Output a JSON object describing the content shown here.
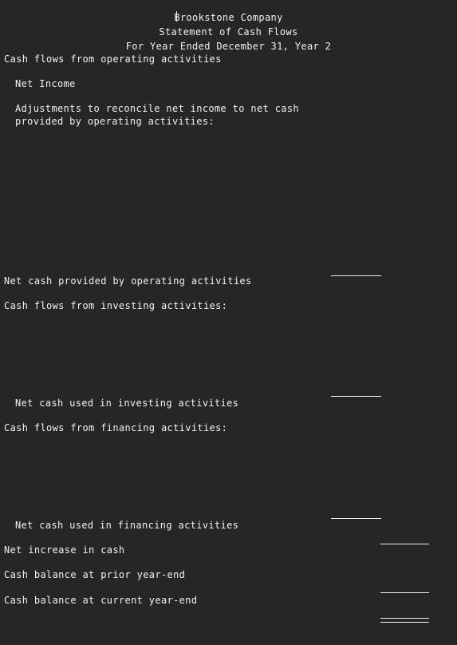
{
  "document": {
    "company": "Brookstone Company",
    "statement_title": "Statement of Cash Flows",
    "period": "For Year Ended December 31, Year 2"
  },
  "sections": {
    "operating": {
      "heading": "Cash flows from operating activities",
      "net_income_label": "Net Income",
      "adjustments_line_1": "Adjustments to reconcile net income to net cash",
      "adjustments_line_2": "provided by operating activities:",
      "subtotal_label": "Net cash provided by operating activities"
    },
    "investing": {
      "heading": "Cash flows from investing activities:",
      "subtotal_label": "Net cash used in investing activities"
    },
    "financing": {
      "heading": "Cash flows from financing activities:",
      "subtotal_label": "Net cash used in financing activities"
    },
    "summary": {
      "net_increase_label": "Net increase in cash",
      "prior_balance_label": "Cash balance at prior year-end",
      "current_balance_label": "Cash balance at current year-end"
    }
  },
  "amounts": {
    "net_income": "",
    "operating_subtotal": "",
    "investing_subtotal": "",
    "financing_subtotal": "",
    "net_increase": "",
    "prior_balance": "",
    "current_balance": ""
  },
  "blank_entry_rows": [
    "",
    "",
    "",
    "",
    "",
    "",
    "",
    "",
    "",
    "",
    "",
    "",
    "",
    "",
    "",
    "",
    "",
    "",
    "",
    "",
    "",
    ""
  ],
  "colors": {
    "background": "#262626",
    "text": "#f2f2f2",
    "rule": "#f2f2f2"
  },
  "caret": {
    "visible": "true"
  }
}
